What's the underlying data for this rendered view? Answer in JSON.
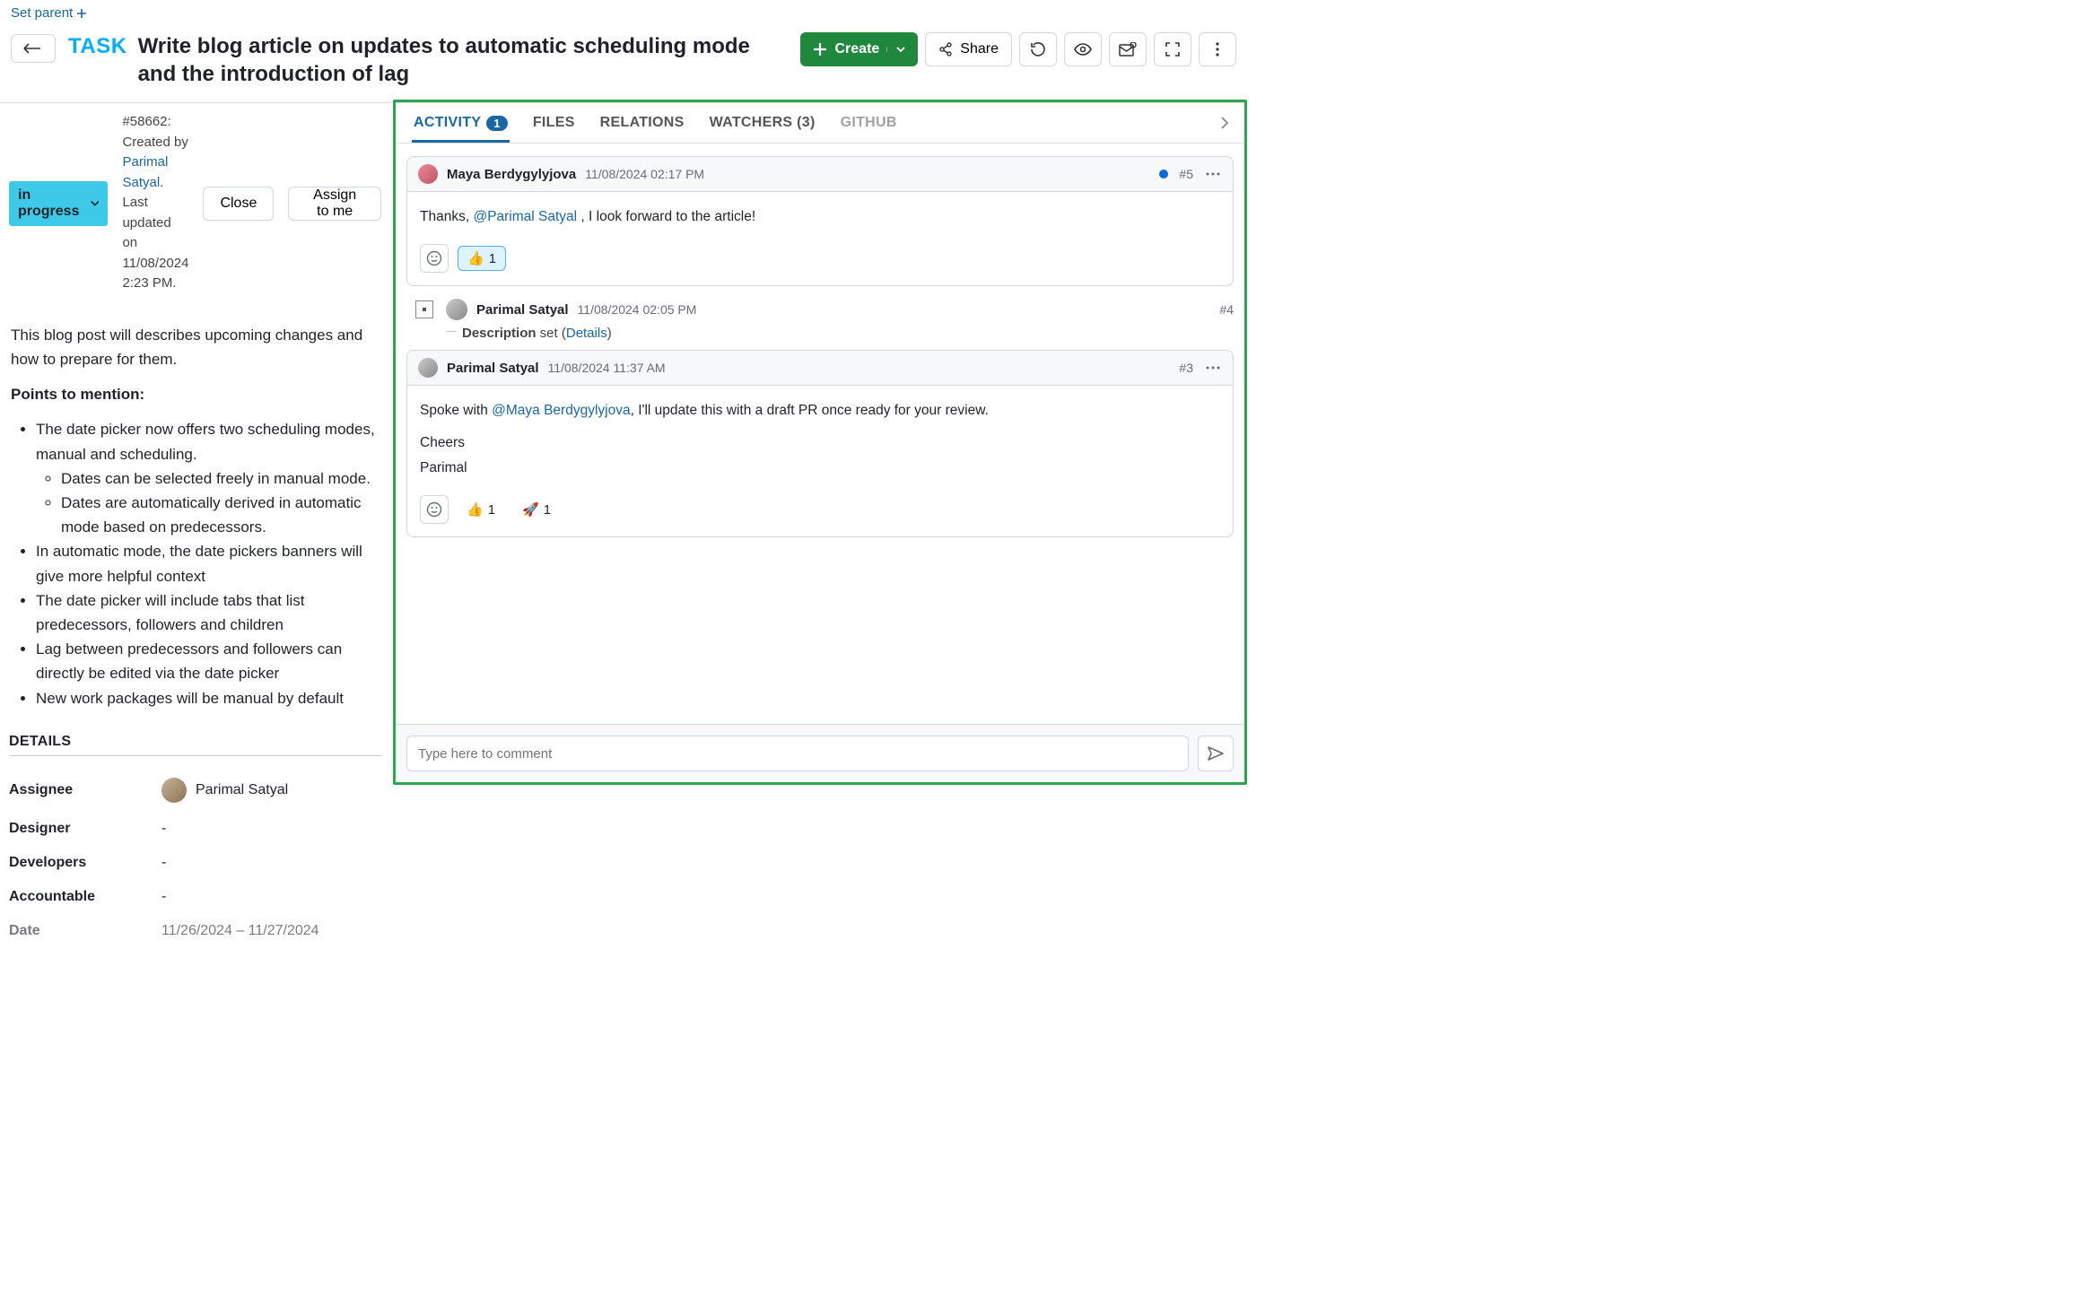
{
  "set_parent": "Set parent",
  "back_aria": "Back",
  "task_badge": "TASK",
  "title": "Write blog article on updates to automatic scheduling mode and the introduction of lag",
  "header": {
    "create": "Create",
    "share": "Share"
  },
  "status": {
    "label": "in progress"
  },
  "meta": {
    "id": "#58662",
    "created_prefix": ": Created by ",
    "creator": "Parimal Satyal",
    "updated_prefix": ". Last updated on ",
    "updated_at": "11/08/2024 2:23 PM."
  },
  "actions": {
    "close": "Close",
    "assign_to_me": "Assign to me"
  },
  "description": {
    "intro": "This blog post will describes upcoming changes and how to prepare for them.",
    "points_header": "Points to mention:",
    "b1": "The date picker now offers two scheduling modes, manual and scheduling.",
    "b1a": "Dates can be selected freely in manual mode.",
    "b1b": "Dates are automatically derived in automatic mode based on predecessors.",
    "b2": "In automatic mode, the date pickers banners will give more helpful context",
    "b3": "The date picker will include tabs that list predecessors, followers and children",
    "b4": "Lag between predecessors and followers can directly be edited via the date picker",
    "b5": "New work packages will be manual by default"
  },
  "details": {
    "header": "DETAILS",
    "rows": {
      "assignee": {
        "label": "Assignee",
        "value": "Parimal Satyal"
      },
      "designer": {
        "label": "Designer",
        "value": "-"
      },
      "developers": {
        "label": "Developers",
        "value": "-"
      },
      "accountable": {
        "label": "Accountable",
        "value": "-"
      },
      "date": {
        "label": "Date",
        "value": "11/26/2024 – 11/27/2024"
      }
    }
  },
  "tabs": {
    "activity": "ACTIVITY",
    "activity_count": "1",
    "files": "FILES",
    "relations": "RELATIONS",
    "watchers": "WATCHERS (3)",
    "github": "GITHUB"
  },
  "activity": {
    "c5": {
      "author": "Maya Berdygylyjova",
      "time": "11/08/2024 02:17 PM",
      "ref": "#5",
      "body_pre": "Thanks, ",
      "mention": "@Parimal Satyal",
      "body_post": " , I look forward to the article!",
      "react_thumbs": "👍",
      "react_thumbs_n": "1"
    },
    "c4": {
      "author": "Parimal Satyal",
      "time": "11/08/2024 02:05 PM",
      "ref": "#4",
      "field": "Description",
      "action": " set (",
      "details": "Details",
      "close": ")"
    },
    "c3": {
      "author": "Parimal Satyal",
      "time": "11/08/2024 11:37 AM",
      "ref": "#3",
      "body_pre": "Spoke with ",
      "mention": "@Maya Berdygylyjova",
      "body_post": ", I'll update this with a draft PR once ready for your review.",
      "line2": "Cheers",
      "line3": "Parimal",
      "react_thumbs": "👍",
      "react_thumbs_n": "1",
      "react_rocket": "🚀",
      "react_rocket_n": "1"
    }
  },
  "comment_placeholder": "Type here to comment"
}
